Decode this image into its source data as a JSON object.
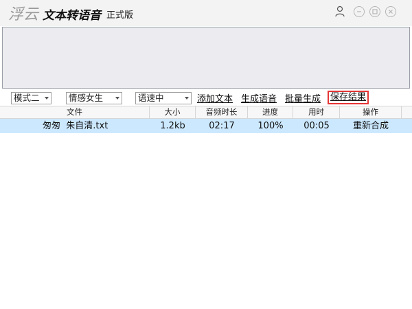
{
  "app": {
    "logo_text": "浮云",
    "name": "文本转语音",
    "edition": "正式版"
  },
  "toolbar": {
    "mode_select": "模式二",
    "voice_select": "情感女生",
    "speed_select": "语速中",
    "add_text": "添加文本",
    "generate_voice": "生成语音",
    "batch_generate": "批量生成",
    "save_result": "保存结果"
  },
  "table": {
    "headers": [
      "文件",
      "大小",
      "音频时长",
      "进度",
      "用时",
      "操作"
    ],
    "rows": [
      {
        "file": "匆匆  朱自清.txt",
        "size": "1.2kb",
        "duration": "02:17",
        "progress": "100%",
        "time": "00:05",
        "action": "重新合成"
      }
    ]
  },
  "colors": {
    "selected_row": "#cce8ff",
    "highlight_border": "#e53535",
    "preview_bg": "#ececf0"
  }
}
